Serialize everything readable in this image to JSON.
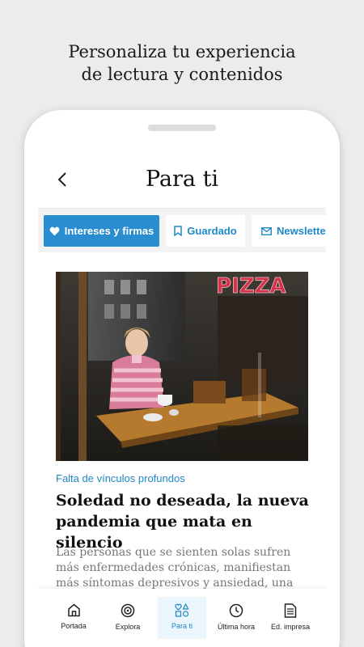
{
  "promo": {
    "line1": "Personaliza tu experiencia",
    "line2": "de lectura y contenidos"
  },
  "header": {
    "back_icon": "chevron-left-icon",
    "title": "Para ti"
  },
  "tabs": [
    {
      "label": "Intereses y firmas",
      "icon": "heart-icon",
      "active": true
    },
    {
      "label": "Guardado",
      "icon": "bookmark-icon",
      "active": false
    },
    {
      "label": "Newsletters",
      "icon": "mail-icon",
      "active": false
    }
  ],
  "article": {
    "image_text": "PIZZA",
    "kicker": "Falta de vínculos profundos",
    "title": "Soledad no deseada, la nueva pandemia que mata en silencio",
    "summary": "Las personas que se sienten solas sufren más enfermedades crónicas, manifiestan más síntomas depresivos y ansiedad, una menor"
  },
  "bottom_nav": [
    {
      "label": "Portada",
      "icon": "home-icon",
      "active": false
    },
    {
      "label": "Explora",
      "icon": "explore-icon",
      "active": false
    },
    {
      "label": "Para ti",
      "icon": "para-ti-icon",
      "active": true
    },
    {
      "label": "Última hora",
      "icon": "clock-icon",
      "active": false
    },
    {
      "label": "Ed. impresa",
      "icon": "newspaper-icon",
      "active": false
    }
  ],
  "colors": {
    "accent": "#2a8dd0",
    "link": "#1e88c7",
    "background": "#ececec"
  }
}
